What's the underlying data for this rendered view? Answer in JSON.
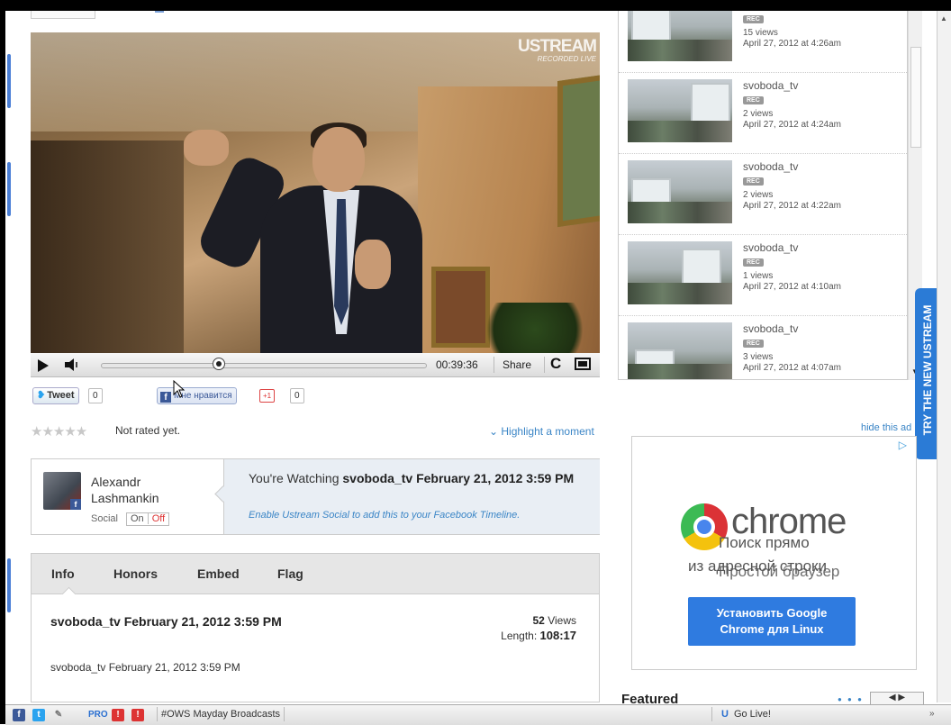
{
  "video": {
    "logo_main": "USTREAM",
    "logo_sub": "RECORDED LIVE",
    "time": "00:39:36",
    "share_label": "Share",
    "progress": 0.36
  },
  "social": {
    "tweet_label": "Tweet",
    "tweet_count": "0",
    "fb_label": "Мне нравится",
    "gplus_label": "+1",
    "gplus_count": "0"
  },
  "rating": {
    "stars": "★★★★★",
    "text": "Not rated yet.",
    "highlight_label": "Highlight a moment"
  },
  "watching": {
    "user_name": "Alexandr Lashmankin",
    "social_label": "Social",
    "toggle_on": "On",
    "toggle_off": "Off",
    "prefix": "You're Watching ",
    "title": "svoboda_tv February 21, 2012 3:59 PM",
    "subtext": "Enable Ustream Social to add this to your Facebook Timeline."
  },
  "tabs": [
    "Info",
    "Honors",
    "Embed",
    "Flag"
  ],
  "info": {
    "title": "svoboda_tv February 21, 2012 3:59 PM",
    "views_count": "52",
    "views_label": " Views",
    "length_label": "Length: ",
    "length_value": "108:17",
    "description": "svoboda_tv February 21, 2012 3:59 PM"
  },
  "recorded_list": [
    {
      "title": "",
      "badge": "REC",
      "views": "15 views",
      "date": "April 27, 2012 at 4:26am"
    },
    {
      "title": "svoboda_tv",
      "badge": "REC",
      "views": "2 views",
      "date": "April 27, 2012 at 4:24am"
    },
    {
      "title": "svoboda_tv",
      "badge": "REC",
      "views": "2 views",
      "date": "April 27, 2012 at 4:22am"
    },
    {
      "title": "svoboda_tv",
      "badge": "REC",
      "views": "1 views",
      "date": "April 27, 2012 at 4:10am"
    },
    {
      "title": "svoboda_tv",
      "badge": "REC",
      "views": "3 views",
      "date": "April 27, 2012 at 4:07am"
    }
  ],
  "sidebar": {
    "hide_ad": "hide this ad",
    "try_new": "TRY THE NEW USTREAM",
    "featured": "Featured"
  },
  "ad": {
    "brand": "chrome",
    "line1": "Поиск прямо",
    "line2": "из адресной строки",
    "line3": "Простой браузер",
    "button_line1": "Установить Google",
    "button_line2": "Chrome для Linux"
  },
  "bottom_bar": {
    "pro_label": "PRO",
    "channel_tab": "#OWS Mayday Broadcasts",
    "go_live": "Go Live!"
  },
  "colors": {
    "link_blue": "#3a85c6",
    "accent_blue": "#2b7bd6",
    "facebook": "#3b5998"
  }
}
